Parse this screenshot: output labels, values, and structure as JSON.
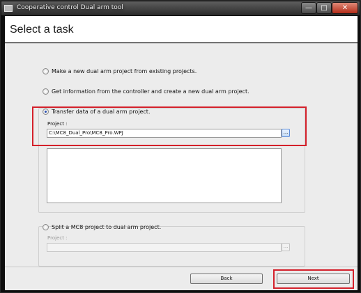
{
  "window": {
    "title": "Cooperative control Dual arm tool",
    "controls": {
      "minimize": "—",
      "maximize": "□",
      "close": "✕"
    }
  },
  "heading": {
    "title": "Select a task"
  },
  "options": [
    {
      "label": "Make a new dual arm project from existing projects.",
      "selected": false
    },
    {
      "label": "Get information from the controller and create a new dual arm project.",
      "selected": false
    },
    {
      "label": "Transfer data of a dual arm project.",
      "selected": true
    },
    {
      "label": "Split a MC8 project to dual arm project.",
      "selected": false
    }
  ],
  "transfer": {
    "project_label": "Project :",
    "project_path": "C:\\MC8_Dual_Pro\\MC8_Pro.WPJ",
    "browse_label": "..."
  },
  "split": {
    "project_label": "Project :",
    "project_path": "",
    "browse_label": "..."
  },
  "buttons": {
    "back": "Back",
    "next": "Next"
  },
  "colors": {
    "highlight": "#d4202a",
    "content_bg": "#ececec",
    "titlebar": "#3a3a3a"
  }
}
